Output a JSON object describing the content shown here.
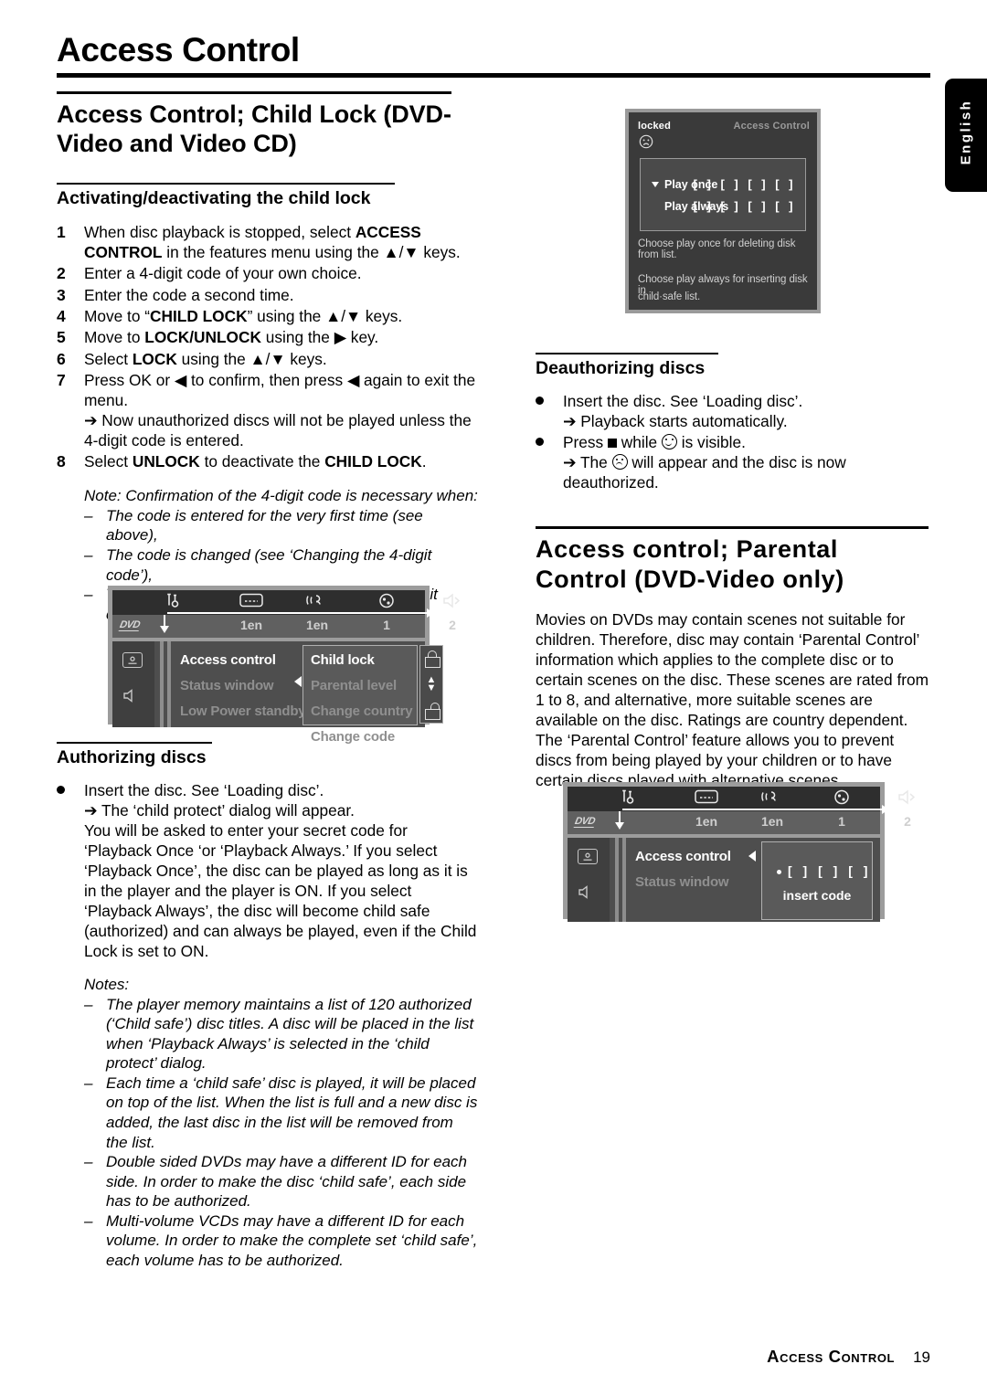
{
  "page_title": "Access Control",
  "language_tab": "English",
  "left_column": {
    "section_heading": "Access Control; Child Lock (DVD-Video and Video CD)",
    "sub_heading": "Activating/deactivating the child lock",
    "steps": [
      {
        "num": "1",
        "text_before": "When disc playback is stopped, select ",
        "bold1": "ACCESS CONTROL",
        "text_mid": " in the features menu using the ▲/▼ keys."
      },
      {
        "num": "2",
        "text": "Enter a 4-digit code of your own choice."
      },
      {
        "num": "3",
        "text": "Enter the code a second time."
      },
      {
        "num": "4",
        "text_before": "Move to “",
        "bold1": "CHILD LOCK",
        "text_mid": "” using the ▲/▼ keys."
      },
      {
        "num": "5",
        "text_before": "Move to ",
        "bold1": "LOCK/UNLOCK",
        "text_mid": " using the ▶ key."
      },
      {
        "num": "6",
        "text_before": "Select ",
        "bold1": "LOCK",
        "text_mid": " using the ▲/▼ keys."
      },
      {
        "num": "7",
        "text": "Press OK or ◀ to confirm, then press ◀ again to exit the menu.",
        "result": "➔ Now unauthorized discs will not be played unless the 4-digit code is entered."
      },
      {
        "num": "8",
        "text_before": "Select ",
        "bold1": "UNLOCK",
        "text_mid": " to deactivate the ",
        "bold2": "CHILD LOCK",
        "text_end": "."
      }
    ],
    "note_intro": "Note: Confirmation of the 4-digit code is necessary when:",
    "note_items": [
      "The code is entered for the very first time (see above),",
      "The code is changed (see ‘Changing the 4-digit code’),",
      "The code is cancelled (see ‘Changing the 4-digit code’)."
    ],
    "authorizing_heading": "Authorizing discs",
    "authorizing_bullet": "Insert the disc. See ‘Loading disc’.",
    "authorizing_arrow": "➔ The ‘child protect’ dialog will appear.",
    "authorizing_body": "You will be asked to enter your secret code for ‘Playback Once ‘or ‘Playback Always.’ If you select ‘Playback Once’, the disc can be played as long as it is in the player and the player is ON. If you select ‘Playback Always’, the disc will become child safe (authorized) and can always be played, even if the Child Lock is set to ON.",
    "notes_label": "Notes:",
    "notes": [
      "The player memory maintains a list of 120 authorized (‘Child safe’) disc titles. A disc will be placed in the list when ‘Playback Always’ is selected in the ‘child protect’ dialog.",
      "Each time a ‘child safe’ disc is played, it will be placed on top of the list. When the list is full and a new disc is added, the last disc in the list will be removed from the list.",
      "Double sided DVDs may have a different ID for each side. In order to make the disc ‘child safe’, each side has to be authorized.",
      "Multi-volume VCDs may have a different ID for each volume. In order to make the complete set ‘child safe’, each volume has to be authorized."
    ]
  },
  "right_column": {
    "deauthorizing_heading": "Deauthorizing discs",
    "deauth_b1": "Insert the disc. See ‘Loading disc’.",
    "deauth_b1_arrow": "➔ Playback starts automatically.",
    "deauth_b2_before": "Press ",
    "deauth_b2_mid": " while ",
    "deauth_b2_end": " is visible.",
    "deauth_b2_arrow_before": "➔ The ",
    "deauth_b2_arrow_end": " will appear and the disc is now deauthorized.",
    "parental_heading": "Access control; Parental Control (DVD-Video only)",
    "parental_body": "Movies on DVDs may contain scenes not suitable for children. Therefore, disc may contain ‘Parental Control’ information which applies to the complete disc or to certain scenes on the disc. These scenes are rated from 1 to 8, and alternative, more suitable scenes are available on the disc. Ratings are country dependent. The ‘Parental Control’ feature allows you to prevent discs from being played by your children or to have certain discs played with alternative scenes."
  },
  "dialog_screenshot": {
    "status_label": "locked",
    "title": "Access Control",
    "option_1": "Play once",
    "option_2": "Play always",
    "code_boxes_1": "[ ] [ ] [ ] [ ]",
    "code_boxes_2": "[ ] [ ] [ ] [ ]",
    "hint_1": "Choose play once for deleting  disk from list.",
    "hint_2": "Choose play always for inserting disk in",
    "hint_3": "child·safe list."
  },
  "osd_screenshot_1": {
    "disc_logo": "DVD",
    "bar_values": [
      "1en",
      "1en",
      "1",
      "2"
    ],
    "menu_items": [
      {
        "label": "Access control",
        "state": "on"
      },
      {
        "label": "Status window",
        "state": "off"
      },
      {
        "label": "Low Power standby",
        "state": "off"
      }
    ],
    "submenu_items": [
      {
        "label": "Child lock",
        "state": "on"
      },
      {
        "label": "Parental level",
        "state": "off"
      },
      {
        "label": "Change country",
        "state": "off"
      },
      {
        "label": "Change code",
        "state": "off"
      }
    ]
  },
  "osd_screenshot_2": {
    "disc_logo": "DVD",
    "bar_values": [
      "1en",
      "1en",
      "1",
      "2"
    ],
    "menu_items": [
      {
        "label": "Access control",
        "state": "on"
      },
      {
        "label": "Status window",
        "state": "off"
      }
    ],
    "code_boxes": "[ ]  [ ]  [ ]",
    "code_caption": "insert code"
  },
  "footer": {
    "section": "Access Control",
    "page_number": "19"
  },
  "colors": {
    "rule": "#000000",
    "osd_frame": "#9c9c9c",
    "osd_bar": "#2e2e2e",
    "osd_sub": "#606060",
    "osd_body": "#4e4e4e",
    "dialog_bg": "#3a3a3a"
  }
}
